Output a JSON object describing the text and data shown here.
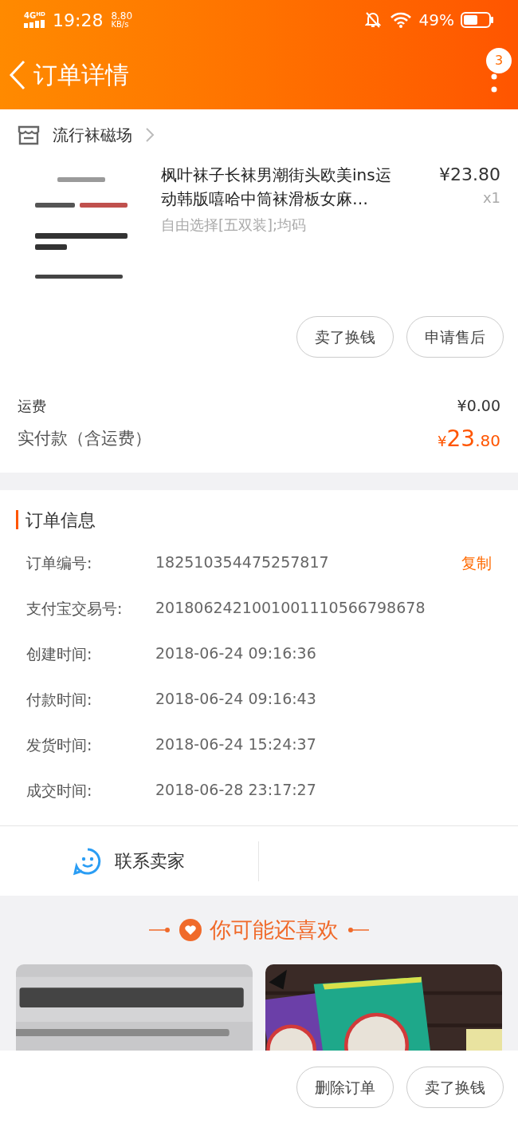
{
  "status_bar": {
    "network": "4G",
    "network_sup": "HD",
    "time": "19:28",
    "speed": "8.80",
    "speed_unit": "KB/s",
    "battery": "49%"
  },
  "nav": {
    "title": "订单详情",
    "badge": "3"
  },
  "shop": {
    "name": "流行袜磁场"
  },
  "product": {
    "title": "枫叶袜子长袜男潮街头欧美ins运动韩版嘻哈中筒袜滑板女麻…",
    "price": "¥23.80",
    "quantity": "x1",
    "sku": "自由选择[五双装];均码"
  },
  "item_buttons": [
    "卖了换钱",
    "申请售后"
  ],
  "fees": [
    {
      "label": "运费",
      "value": "¥0.00",
      "kind": "plain"
    },
    {
      "label": "实付款（含运费）",
      "currency": "¥",
      "value": "23",
      "decimals": ".80",
      "kind": "total"
    }
  ],
  "order_info": {
    "title": "订单信息",
    "copy": "复制",
    "rows": [
      {
        "label": "订单编号:",
        "value": "182510354475257817"
      },
      {
        "label": "支付宝交易号:",
        "value": "2018062421001001110566798678"
      },
      {
        "label": "创建时间:",
        "value": "2018-06-24 09:16:36"
      },
      {
        "label": "付款时间:",
        "value": "2018-06-24 09:16:43"
      },
      {
        "label": "发货时间:",
        "value": "2018-06-24 15:24:37"
      },
      {
        "label": "成交时间:",
        "value": "2018-06-28 23:17:27"
      }
    ]
  },
  "contact": {
    "label": "联系卖家"
  },
  "recommend": {
    "title": "你可能还喜欢"
  },
  "bottom_buttons": [
    "删除订单",
    "卖了换钱"
  ]
}
